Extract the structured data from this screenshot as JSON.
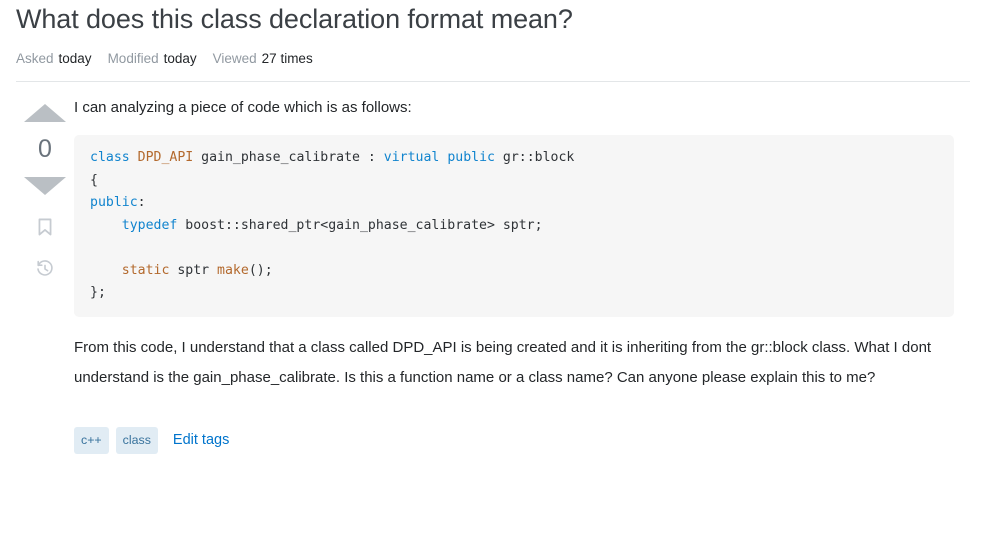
{
  "question": {
    "title": "What does this class declaration format mean?",
    "meta": [
      {
        "label": "Asked",
        "value": "today"
      },
      {
        "label": "Modified",
        "value": "today"
      },
      {
        "label": "Viewed",
        "value": "27 times"
      }
    ],
    "votes": {
      "score": "0",
      "upvote_icon": "triangle-up-icon",
      "downvote_icon": "triangle-down-icon",
      "bookmark_icon": "bookmark-icon",
      "history_icon": "history-icon"
    },
    "body": {
      "paragraph_1": "I can analyzing a piece of code which is as follows:",
      "paragraph_2": "From this code, I understand that a class called DPD_API is being created and it is inheriting from the gr::block class. What I dont understand is the gain_phase_calibrate. Is this a function name or a class name? Can anyone please explain this to me?",
      "code": {
        "lines": [
          [
            {
              "t": "class",
              "c": "kw"
            },
            {
              "t": " ",
              "c": "pln"
            },
            {
              "t": "DPD_API",
              "c": "def"
            },
            {
              "t": " gain_phase_calibrate : ",
              "c": "pln"
            },
            {
              "t": "virtual",
              "c": "kw"
            },
            {
              "t": " ",
              "c": "pln"
            },
            {
              "t": "public",
              "c": "kw"
            },
            {
              "t": " gr::block",
              "c": "pln"
            }
          ],
          [
            {
              "t": "{",
              "c": "pln"
            }
          ],
          [
            {
              "t": "public",
              "c": "kw"
            },
            {
              "t": ":",
              "c": "pln"
            }
          ],
          [
            {
              "t": "    ",
              "c": "pln"
            },
            {
              "t": "typedef",
              "c": "kw"
            },
            {
              "t": " boost::shared_ptr<gain_phase_calibrate> sptr;",
              "c": "pln"
            }
          ],
          [
            {
              "t": "",
              "c": "pln"
            }
          ],
          [
            {
              "t": "    ",
              "c": "pln"
            },
            {
              "t": "static",
              "c": "def"
            },
            {
              "t": " sptr ",
              "c": "pln"
            },
            {
              "t": "make",
              "c": "def"
            },
            {
              "t": "();",
              "c": "pln"
            }
          ],
          [
            {
              "t": "};",
              "c": "pln"
            }
          ]
        ]
      }
    },
    "tags": [
      "c++",
      "class"
    ],
    "edit_tags_label": "Edit tags"
  },
  "colors": {
    "title": "#3b4045",
    "meta_label": "#9199a1",
    "code_background": "#f6f6f6",
    "code_keyword": "#1184ce",
    "code_definition": "#b3692d",
    "tag_background": "#e1ecf4",
    "tag_text": "#39739d",
    "link": "#0074cc",
    "vote_arrow": "#babfc4"
  }
}
